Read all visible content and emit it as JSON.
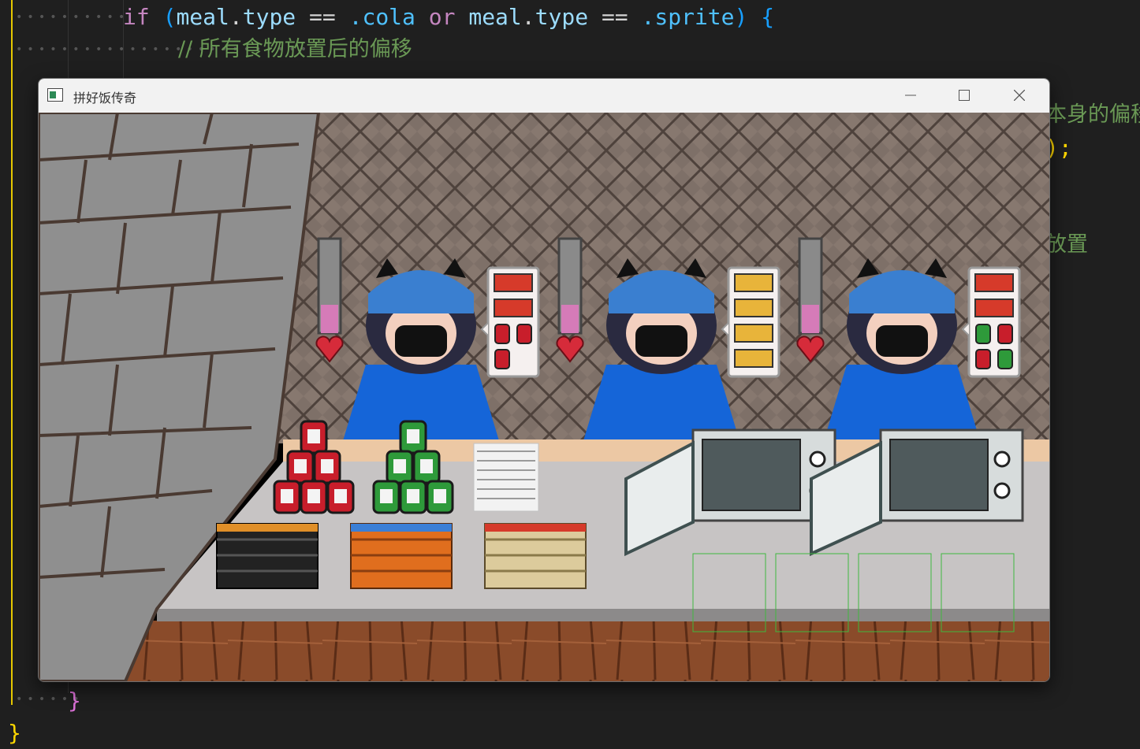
{
  "editor": {
    "line1": {
      "kw_if": "if",
      "paren_open": "(",
      "meal1": "meal",
      "dot1": ".",
      "type1": "type",
      "eq1": "==",
      "cola": ".cola",
      "or": "or",
      "meal2": "meal",
      "dot2": ".",
      "type2": "type",
      "eq2": "==",
      "sprite": ".sprite",
      "paren_close": ")",
      "brace_open": "{"
    },
    "comment1": "// 所有食物放置后的偏移",
    "partial_right_1": "本身的偏移",
    "partial_right_2": ");",
    "partial_right_3": "放置",
    "close_inner": "}",
    "close_outer": "}"
  },
  "window": {
    "title": "拼好饭传奇",
    "minimize_label": "minimize",
    "maximize_label": "maximize",
    "close_label": "close"
  },
  "colors": {
    "editor_bg": "#1f1f1f",
    "titlebar_bg": "#f2f2f2",
    "hitbox_green": "#3fb83f",
    "customer_blue": "#1565d8",
    "patience_pink": "#d57bb8",
    "heart_red": "#d62b3a",
    "cola_red": "#c81e2b",
    "sprite_green": "#2e9a3a"
  },
  "scene": {
    "customers": [
      {
        "patience_fraction": 0.3,
        "order": [
          "meal-red",
          "meal-red",
          "cola",
          "cola",
          "cola"
        ]
      },
      {
        "patience_fraction": 0.3,
        "order": [
          "meal-yellow",
          "meal-yellow",
          "meal-yellow",
          "meal-yellow"
        ]
      },
      {
        "patience_fraction": 0.3,
        "order": [
          "meal-red",
          "meal-red",
          "sprite",
          "cola",
          "cola",
          "sprite"
        ]
      }
    ],
    "stations": [
      "cola-stack",
      "sprite-stack",
      "plate-stack",
      "meal-box-black",
      "meal-box-orange",
      "meal-box-tan",
      "microwave-1",
      "microwave-2"
    ],
    "drop_slots": 4
  }
}
